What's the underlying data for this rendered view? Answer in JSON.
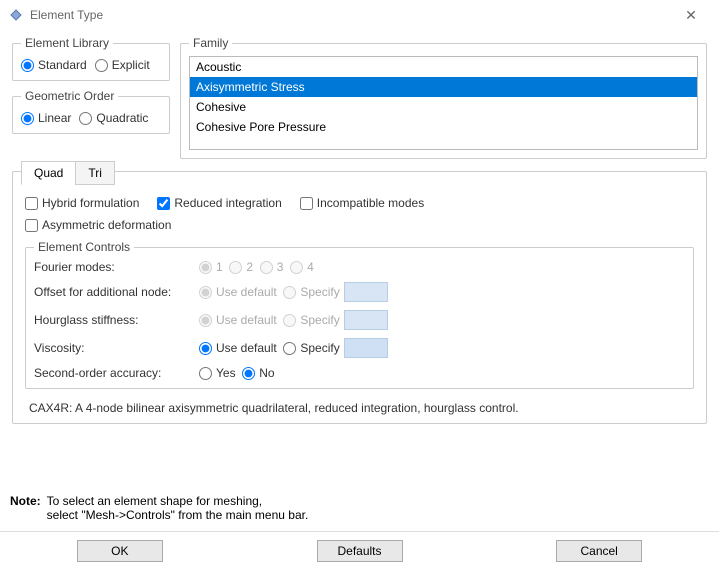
{
  "window": {
    "title": "Element Type"
  },
  "element_library": {
    "legend": "Element Library",
    "options": {
      "standard": "Standard",
      "explicit": "Explicit"
    },
    "selected": "standard"
  },
  "geometric_order": {
    "legend": "Geometric Order",
    "options": {
      "linear": "Linear",
      "quadratic": "Quadratic"
    },
    "selected": "linear"
  },
  "family": {
    "legend": "Family",
    "items": [
      "Acoustic",
      "Axisymmetric Stress",
      "Cohesive",
      "Cohesive Pore Pressure"
    ],
    "selected_index": 1
  },
  "tabs": {
    "quad": "Quad",
    "tri": "Tri",
    "active": "quad"
  },
  "quad_opts": {
    "hybrid": "Hybrid formulation",
    "reduced": "Reduced integration",
    "incompat": "Incompatible modes",
    "asym": "Asymmetric deformation",
    "reduced_checked": true
  },
  "controls": {
    "legend": "Element Controls",
    "fourier": {
      "label": "Fourier modes:",
      "opts": [
        "1",
        "2",
        "3",
        "4"
      ]
    },
    "offset": {
      "label": "Offset for additional node:",
      "use_default": "Use default",
      "specify": "Specify"
    },
    "hourglass": {
      "label": "Hourglass stiffness:",
      "use_default": "Use default",
      "specify": "Specify"
    },
    "viscosity": {
      "label": "Viscosity:",
      "use_default": "Use default",
      "specify": "Specify"
    },
    "second": {
      "label": "Second-order accuracy:",
      "yes": "Yes",
      "no": "No"
    }
  },
  "description": "CAX4R:  A 4-node bilinear axisymmetric quadrilateral, reduced integration, hourglass control.",
  "note": {
    "label": "Note:",
    "line1": "To select an element shape for meshing,",
    "line2": "select \"Mesh->Controls\" from the main menu bar."
  },
  "buttons": {
    "ok": "OK",
    "defaults": "Defaults",
    "cancel": "Cancel"
  }
}
